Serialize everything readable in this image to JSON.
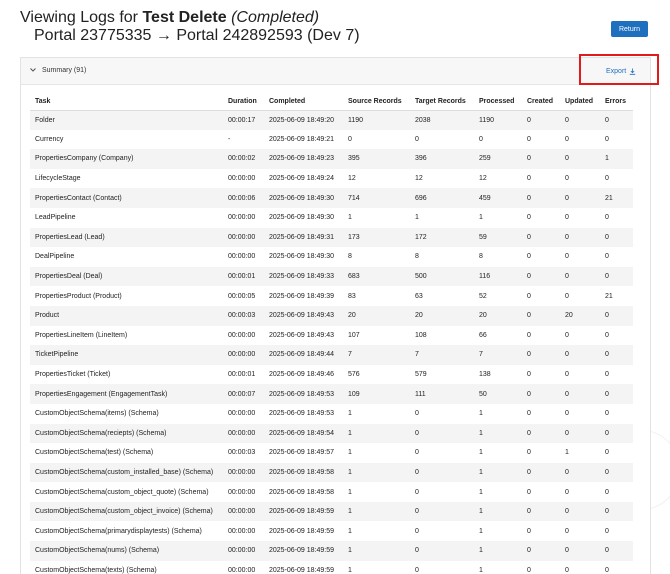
{
  "header": {
    "prefix": "Viewing Logs for ",
    "name": "Test Delete",
    "status": "(Completed)",
    "subtitle": "Portal 23775335 → Portal 242892593 (Dev 7)",
    "return_label": "Return"
  },
  "panel": {
    "summary_label": "Summary (91)",
    "export_label": "Export"
  },
  "table": {
    "columns": [
      "Task",
      "Duration",
      "Completed",
      "Source Records",
      "Target Records",
      "Processed",
      "Created",
      "Updated",
      "Errors"
    ],
    "rows": [
      [
        "Folder",
        "00:00:17",
        "2025-06-09 18:49:20",
        "1190",
        "2038",
        "1190",
        "0",
        "0",
        "0"
      ],
      [
        "Currency",
        "-",
        "2025-06-09 18:49:21",
        "0",
        "0",
        "0",
        "0",
        "0",
        "0"
      ],
      [
        "PropertiesCompany (Company)",
        "00:00:02",
        "2025-06-09 18:49:23",
        "395",
        "396",
        "259",
        "0",
        "0",
        "1"
      ],
      [
        "LifecycleStage",
        "00:00:00",
        "2025-06-09 18:49:24",
        "12",
        "12",
        "12",
        "0",
        "0",
        "0"
      ],
      [
        "PropertiesContact (Contact)",
        "00:00:06",
        "2025-06-09 18:49:30",
        "714",
        "696",
        "459",
        "0",
        "0",
        "21"
      ],
      [
        "LeadPipeline",
        "00:00:00",
        "2025-06-09 18:49:30",
        "1",
        "1",
        "1",
        "0",
        "0",
        "0"
      ],
      [
        "PropertiesLead (Lead)",
        "00:00:00",
        "2025-06-09 18:49:31",
        "173",
        "172",
        "59",
        "0",
        "0",
        "0"
      ],
      [
        "DealPipeline",
        "00:00:00",
        "2025-06-09 18:49:30",
        "8",
        "8",
        "8",
        "0",
        "0",
        "0"
      ],
      [
        "PropertiesDeal (Deal)",
        "00:00:01",
        "2025-06-09 18:49:33",
        "683",
        "500",
        "116",
        "0",
        "0",
        "0"
      ],
      [
        "PropertiesProduct (Product)",
        "00:00:05",
        "2025-06-09 18:49:39",
        "83",
        "63",
        "52",
        "0",
        "0",
        "21"
      ],
      [
        "Product",
        "00:00:03",
        "2025-06-09 18:49:43",
        "20",
        "20",
        "20",
        "0",
        "20",
        "0"
      ],
      [
        "PropertiesLineItem (LineItem)",
        "00:00:00",
        "2025-06-09 18:49:43",
        "107",
        "108",
        "66",
        "0",
        "0",
        "0"
      ],
      [
        "TicketPipeline",
        "00:00:00",
        "2025-06-09 18:49:44",
        "7",
        "7",
        "7",
        "0",
        "0",
        "0"
      ],
      [
        "PropertiesTicket (Ticket)",
        "00:00:01",
        "2025-06-09 18:49:46",
        "576",
        "579",
        "138",
        "0",
        "0",
        "0"
      ],
      [
        "PropertiesEngagement (EngagementTask)",
        "00:00:07",
        "2025-06-09 18:49:53",
        "109",
        "111",
        "50",
        "0",
        "0",
        "0"
      ],
      [
        "CustomObjectSchema(items) (Schema)",
        "00:00:00",
        "2025-06-09 18:49:53",
        "1",
        "0",
        "1",
        "0",
        "0",
        "0"
      ],
      [
        "CustomObjectSchema(reciepts) (Schema)",
        "00:00:00",
        "2025-06-09 18:49:54",
        "1",
        "0",
        "1",
        "0",
        "0",
        "0"
      ],
      [
        "CustomObjectSchema(test) (Schema)",
        "00:00:03",
        "2025-06-09 18:49:57",
        "1",
        "0",
        "1",
        "0",
        "1",
        "0"
      ],
      [
        "CustomObjectSchema(custom_installed_base) (Schema)",
        "00:00:00",
        "2025-06-09 18:49:58",
        "1",
        "0",
        "1",
        "0",
        "0",
        "0"
      ],
      [
        "CustomObjectSchema(custom_object_quote) (Schema)",
        "00:00:00",
        "2025-06-09 18:49:58",
        "1",
        "0",
        "1",
        "0",
        "0",
        "0"
      ],
      [
        "CustomObjectSchema(custom_object_invoice) (Schema)",
        "00:00:00",
        "2025-06-09 18:49:59",
        "1",
        "0",
        "1",
        "0",
        "0",
        "0"
      ],
      [
        "CustomObjectSchema(primarydisplaytests) (Schema)",
        "00:00:00",
        "2025-06-09 18:49:59",
        "1",
        "0",
        "1",
        "0",
        "0",
        "0"
      ],
      [
        "CustomObjectSchema(nums) (Schema)",
        "00:00:00",
        "2025-06-09 18:49:59",
        "1",
        "0",
        "1",
        "0",
        "0",
        "0"
      ],
      [
        "CustomObjectSchema(texts) (Schema)",
        "00:00:00",
        "2025-06-09 18:49:59",
        "1",
        "0",
        "1",
        "0",
        "0",
        "0"
      ]
    ]
  },
  "colors": {
    "accent": "#1f6fbf",
    "highlight_border": "#e01b1b",
    "stripe": "#f4f4f4"
  }
}
